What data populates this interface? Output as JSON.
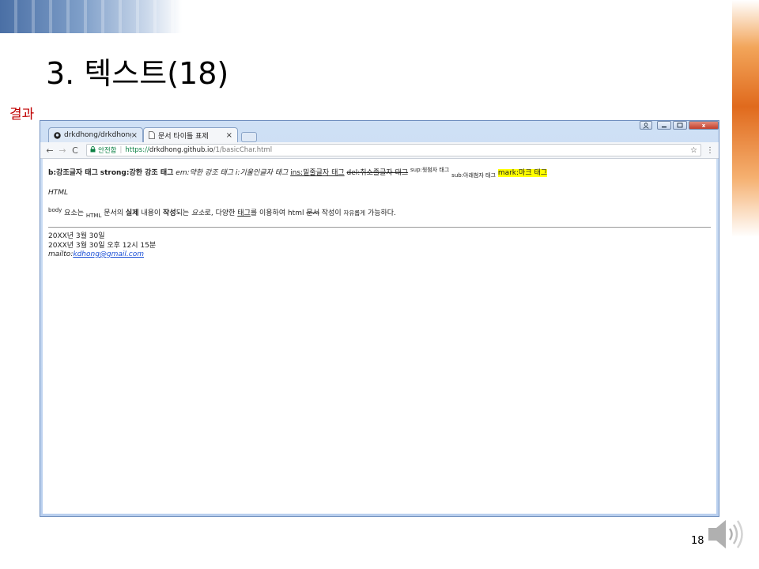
{
  "slide": {
    "title": "3. 텍스트(18)",
    "result_label": "결과",
    "page_number": "18"
  },
  "browser": {
    "tabs": [
      {
        "label": "drkdhong/drkdhong.gith",
        "icon": "github-icon",
        "close": "×"
      },
      {
        "label": "문서 타이틀 표제",
        "icon": "document-icon",
        "close": "×"
      }
    ],
    "window_close": "x",
    "toolbar": {
      "back": "←",
      "forward": "→",
      "reload": "C",
      "secure_text": "안전함",
      "url_prefix": "https://",
      "url_host": "drkdhong.github.io",
      "url_path": "/1/basicChar.html",
      "star": "☆",
      "menu": "⋮"
    }
  },
  "content": {
    "line1": {
      "b": "b:강조글자 태그",
      "strong": "strong:강한 강조 태그",
      "em": "em:약한 강조 태그",
      "i": "i:기울인글자 태그",
      "ins": "ins:밑줄글자 태그",
      "del": "del:취소줄글자 태그",
      "sup": "sup:윗첨자 태그",
      "sub": "sub:아래첨자 태그",
      "mark": "mark:마크 태그"
    },
    "html_line": "HTML",
    "para": {
      "sup_body": "body",
      "t1": " 요소는 ",
      "sub_html": "HTML",
      "t2": " 문서의 ",
      "b_silje": "실제",
      "t3": " 내용이 ",
      "strong_jak": "작성",
      "t4": "되는 ",
      "em_yoso": "요소",
      "t5": "로, 다양한 ",
      "ins_tag": "태그",
      "t6": "를 이용하여 html ",
      "del_doc": "문서",
      "t7": " 작성이 ",
      "small_free": "자유롭게",
      "t8": " 가능하다."
    },
    "date1": "20XX년 3월 30일",
    "date2": "20XX년 3월 30일 오후 12시 15분",
    "mail_prefix": "mailto:",
    "mail_link": "kdhong@gmail.com"
  }
}
